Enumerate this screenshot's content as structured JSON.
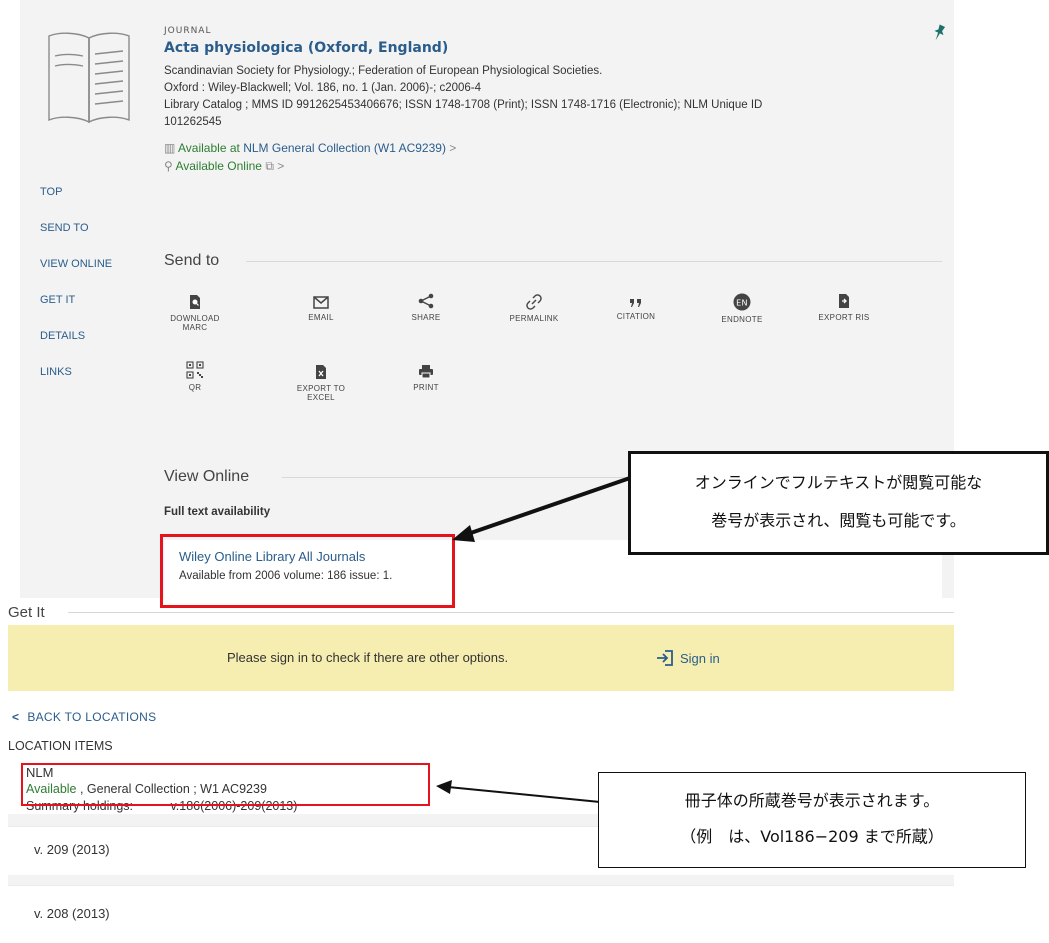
{
  "record": {
    "type": "JOURNAL",
    "title": "Acta physiologica (Oxford, England)",
    "authors": "Scandinavian Society for Physiology.; Federation of European Physiological Societies.",
    "publisher": "Oxford : Wiley-Blackwell; Vol. 186, no. 1 (Jan. 2006)-; c2006-4",
    "catalog_line1": "Library Catalog ; MMS ID 9912625453406676; ISSN 1748-1708 (Print); ISSN 1748-1716 (Electronic); NLM Unique ID",
    "catalog_line2": "101262545",
    "available_at_prefix": "Available at",
    "available_at_location": "NLM  General Collection (W1 AC9239)",
    "available_online": "Available Online",
    "chevron": ">"
  },
  "nav": {
    "items": [
      "TOP",
      "SEND TO",
      "VIEW ONLINE",
      "GET IT",
      "DETAILS",
      "LINKS"
    ]
  },
  "send_to": {
    "heading": "Send to",
    "actions": [
      {
        "line1": "DOWNLOAD",
        "line2": "MARC",
        "icon": "download-marc-icon"
      },
      {
        "line1": "EMAIL",
        "line2": "",
        "icon": "envelope-icon"
      },
      {
        "line1": "SHARE",
        "line2": "",
        "icon": "share-icon"
      },
      {
        "line1": "PERMALINK",
        "line2": "",
        "icon": "link-icon"
      },
      {
        "line1": "CITATION",
        "line2": "",
        "icon": "quote-icon"
      },
      {
        "line1": "ENDNOTE",
        "line2": "",
        "icon": "endnote-icon",
        "badge": "EN"
      },
      {
        "line1": "EXPORT RIS",
        "line2": "",
        "icon": "file-export-icon"
      },
      {
        "line1": "QR",
        "line2": "",
        "icon": "qr-code-icon"
      },
      {
        "line1": "EXPORT TO",
        "line2": "EXCEL",
        "icon": "excel-file-icon"
      },
      {
        "line1": "PRINT",
        "line2": "",
        "icon": "printer-icon"
      }
    ]
  },
  "view_online": {
    "heading": "View Online",
    "full_text_label": "Full text availability",
    "service_name": "Wiley Online Library All Journals",
    "service_range": "Available from 2006 volume: 186 issue: 1."
  },
  "get_it": {
    "heading": "Get It",
    "signin_message": "Please sign in to check if there are other options.",
    "signin_link": "Sign in",
    "back_link": "BACK TO LOCATIONS",
    "location_items_label": "LOCATION ITEMS",
    "location_name": "NLM",
    "status_available": "Available",
    "status_rest": " , General Collection ; W1 AC9239",
    "summary_label": "Summary holdings:",
    "summary_value": "v.186(2006)-209(2013)",
    "volumes": [
      "v. 209 (2013)",
      "v. 208 (2013)"
    ]
  },
  "callouts": {
    "online_line1": "オンラインでフルテキストが閲覧可能な",
    "online_line2": "巻号が表示され、閲覧も可能です。",
    "holdings_line1": "冊子体の所蔵巻号が表示されます。",
    "holdings_line2": "（例　は、Vol186−209 まで所蔵）"
  },
  "colors": {
    "link": "#2a5d8c",
    "available": "#2e7d32",
    "highlight_box": "#e5131b",
    "signin_bar": "#f6eeb0",
    "panel_bg": "#f3f3f3",
    "pin": "#1f6f6a"
  }
}
